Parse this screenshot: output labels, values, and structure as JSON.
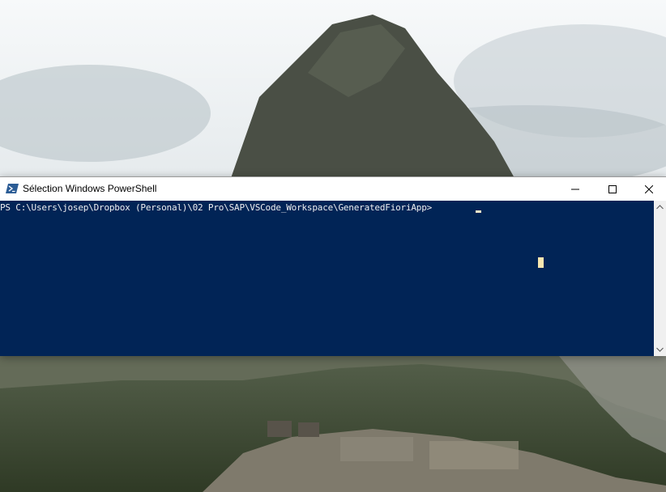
{
  "window": {
    "title": "Sélection Windows PowerShell",
    "icon": "powershell-icon",
    "controls": [
      "minimize-icon",
      "maximize-icon",
      "close-icon"
    ]
  },
  "console": {
    "prompt": "PS C:\\Users\\josep\\Dropbox (Personal)\\02 Pro\\SAP\\VSCode_Workspace\\GeneratedFioriApp> ",
    "background_color": "#012456",
    "text_color": "#eeedf0"
  },
  "scrollbar": {
    "up_icon": "chevron-up-icon",
    "down_icon": "chevron-down-icon"
  },
  "desktop": {
    "wallpaper": "mountain-landscape"
  }
}
